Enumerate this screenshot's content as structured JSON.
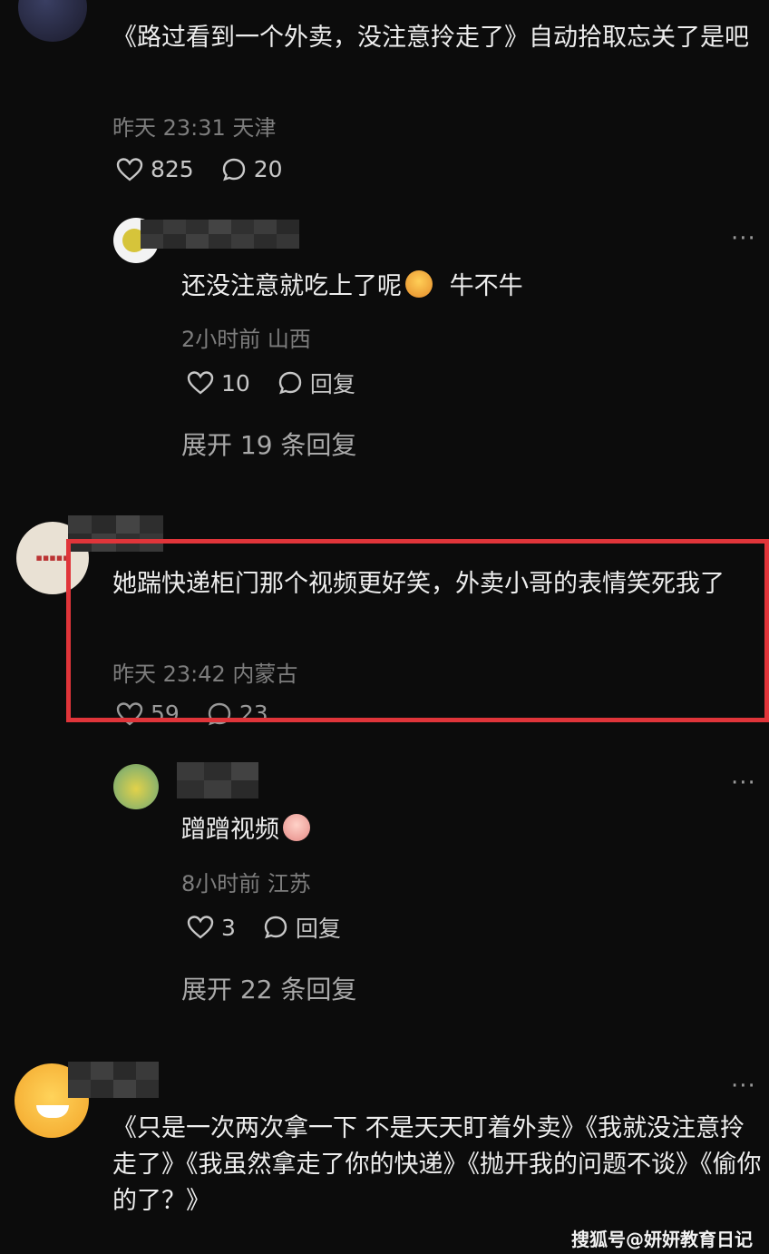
{
  "comments": [
    {
      "text": "《路过看到一个外卖，没注意拎走了》自动拾取忘关了是吧",
      "meta": "昨天 23:31 天津",
      "likes": "825",
      "replies": "20",
      "reply": {
        "text": "还没注意就吃上了呢",
        "emoji_suffix": "牛不牛",
        "meta": "2小时前 山西",
        "likes": "10",
        "reply_label": "回复",
        "expand": "展开 19 条回复"
      }
    },
    {
      "text": "她踹快递柜门那个视频更好笑，外卖小哥的表情笑死我了",
      "meta": "昨天 23:42 内蒙古",
      "likes": "59",
      "replies": "23",
      "reply": {
        "text": "蹭蹭视频",
        "meta": "8小时前 江苏",
        "likes": "3",
        "reply_label": "回复",
        "expand": "展开 22 条回复"
      }
    },
    {
      "text": "《只是一次两次拿一下 不是天天盯着外卖》《我就没注意拎走了》《我虽然拿走了你的快递》《抛开我的问题不谈》《偷你的了？》"
    }
  ],
  "more_label": "···",
  "watermark": "搜狐号@妍妍教育日记",
  "colors": {
    "highlight": "#e0353a",
    "background": "#0c0c0c"
  }
}
